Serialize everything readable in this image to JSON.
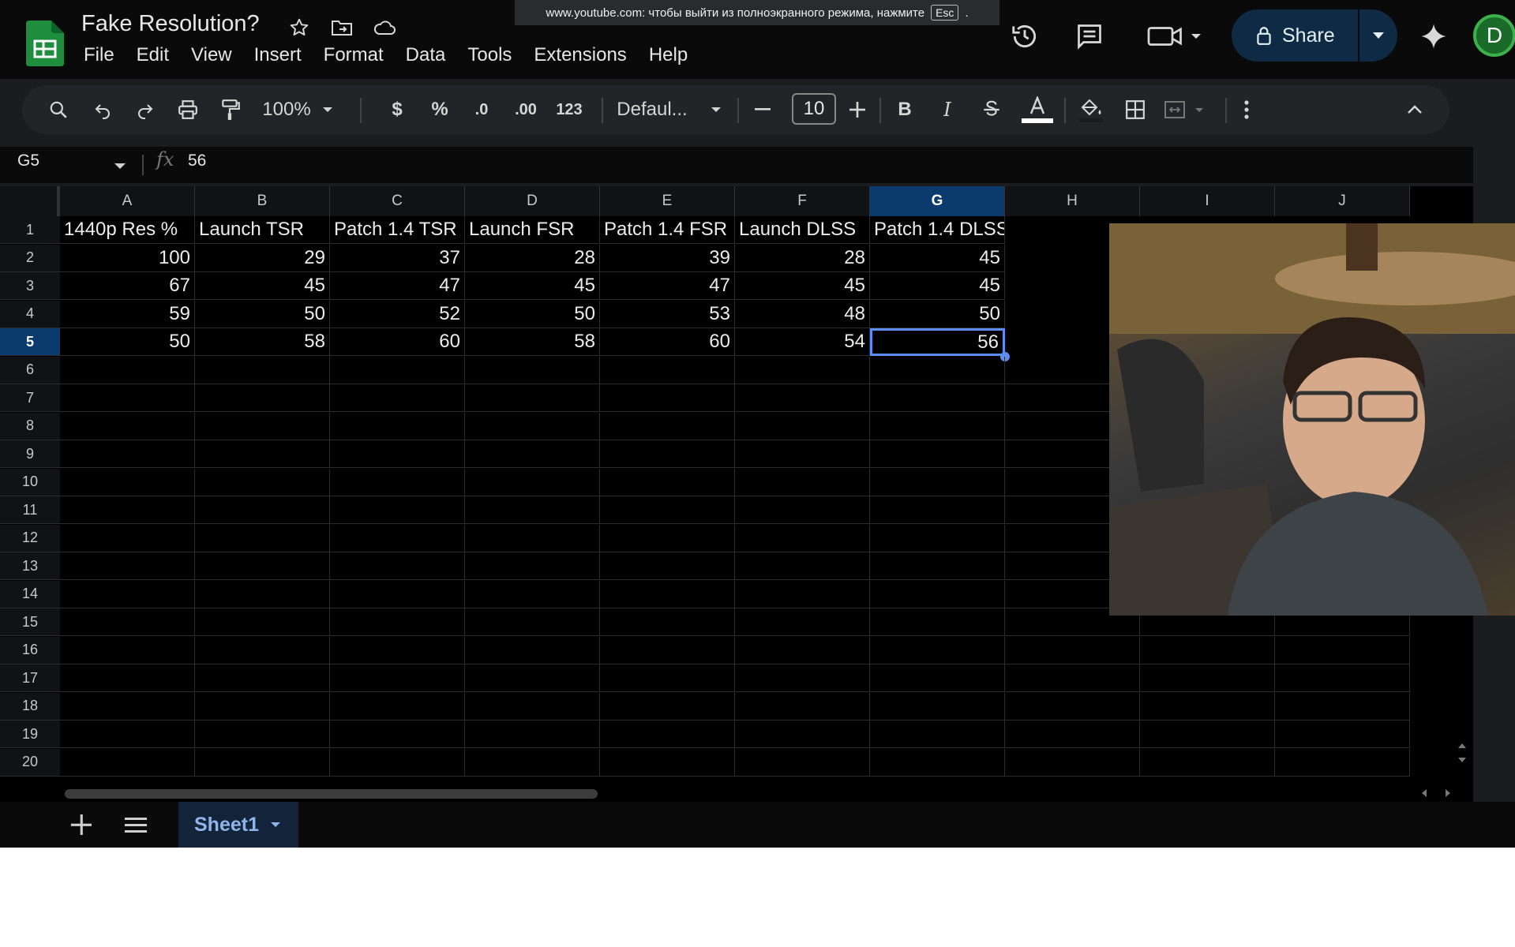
{
  "doc": {
    "title": "Fake Resolution?"
  },
  "browser_banner": {
    "text": "www.youtube.com: чтобы выйти из полноэкранного режима, нажмите",
    "key": "Esc",
    "tail": "."
  },
  "menu": [
    "File",
    "Edit",
    "View",
    "Insert",
    "Format",
    "Data",
    "Tools",
    "Extensions",
    "Help"
  ],
  "header": {
    "share_label": "Share",
    "avatar_letter": "D"
  },
  "toolbar": {
    "zoom": "100%",
    "currency": "$",
    "percent": "%",
    "dec_less": ".0",
    "dec_more": ".00",
    "number_format": "123",
    "font": "Defaul...",
    "font_size": "10",
    "bold": "B",
    "italic": "I"
  },
  "formula_bar": {
    "cell_ref": "G5",
    "fx": "fx",
    "value": "56"
  },
  "columns": [
    "A",
    "B",
    "C",
    "D",
    "E",
    "F",
    "G",
    "H",
    "I",
    "J"
  ],
  "selected_column": "G",
  "selected_row": 5,
  "rows": [
    "1",
    "2",
    "3",
    "4",
    "5",
    "6",
    "7",
    "8",
    "9",
    "10",
    "11",
    "12",
    "13",
    "14",
    "15",
    "16",
    "17",
    "18",
    "19",
    "20"
  ],
  "table": {
    "headers": [
      "1440p Res %",
      "Launch TSR",
      "Patch 1.4 TSR",
      "Launch FSR",
      "Patch 1.4 FSR",
      "Launch DLSS",
      "Patch 1.4 DLSS"
    ],
    "data": [
      [
        "100",
        "29",
        "37",
        "28",
        "39",
        "28",
        "45"
      ],
      [
        "67",
        "45",
        "47",
        "45",
        "47",
        "45",
        "45"
      ],
      [
        "59",
        "50",
        "52",
        "50",
        "53",
        "48",
        "50"
      ],
      [
        "50",
        "58",
        "60",
        "58",
        "60",
        "54",
        "56"
      ]
    ]
  },
  "sheets": [
    {
      "name": "Sheet1",
      "active": true
    }
  ],
  "colors": {
    "accent": "#5b8ef0",
    "selected_header": "#0b3b6e",
    "share_bg": "#0f2a44",
    "logo_green": "#1e8e3e"
  }
}
